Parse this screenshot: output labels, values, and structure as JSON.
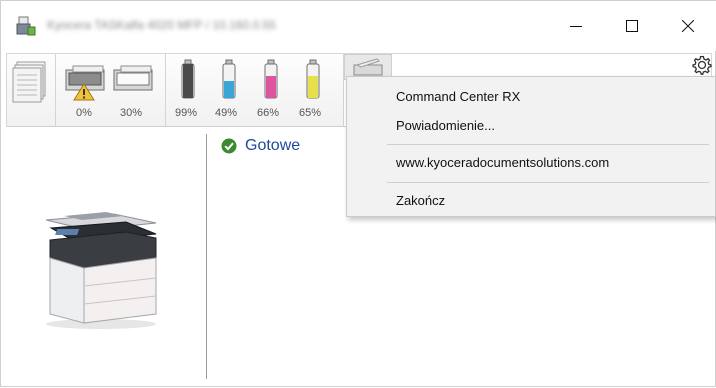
{
  "window": {
    "title": "Kyocera TASKalfa 4020 MFP / 10.160.0.55",
    "controls": {
      "minimize": "minimize-icon",
      "maximize": "maximize-icon",
      "close": "close-icon"
    }
  },
  "toolbar": {
    "paper_trays": [
      {
        "name": "tray-1",
        "level": "0%",
        "warning": true
      },
      {
        "name": "tray-2",
        "level": "30%",
        "warning": false
      }
    ],
    "toners": [
      {
        "name": "black",
        "level": "99%",
        "fraction": 0.99,
        "color": "#4a4a4a"
      },
      {
        "name": "cyan",
        "level": "49%",
        "fraction": 0.49,
        "color": "#3aa6d6"
      },
      {
        "name": "magenta",
        "level": "66%",
        "fraction": 0.66,
        "color": "#e0549f"
      },
      {
        "name": "yellow",
        "level": "65%",
        "fraction": 0.65,
        "color": "#e6e04a"
      }
    ]
  },
  "status": {
    "text": "Gotowe",
    "color": "#1f4a9a"
  },
  "context_menu": {
    "items": [
      "Command Center RX",
      "Powiadomienie...",
      "www.kyoceradocumentsolutions.com",
      "Zakończ"
    ]
  },
  "icons": {
    "app": "printer-app-icon",
    "settings": "gear-icon",
    "status": "check-icon",
    "documents": "documents-stack-icon",
    "scanner": "scanner-icon"
  }
}
